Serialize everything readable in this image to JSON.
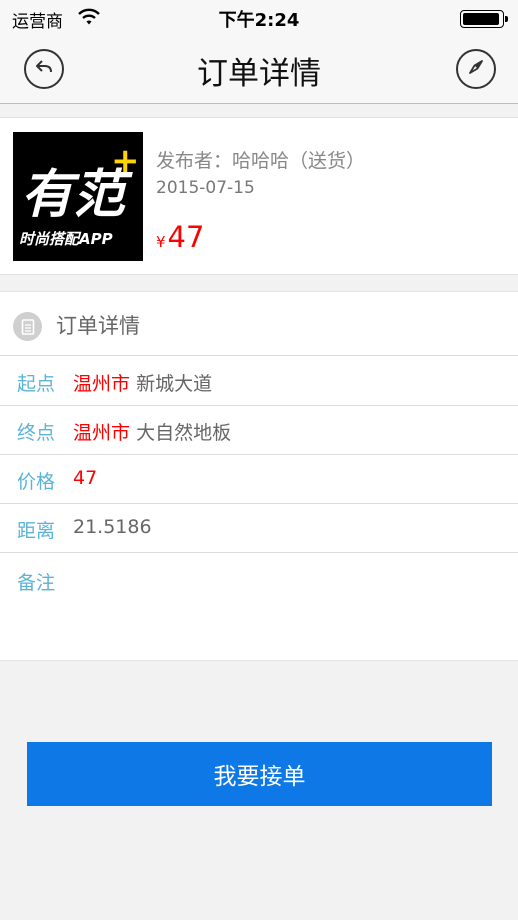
{
  "status": {
    "carrier": "运营商",
    "time": "下午2:24"
  },
  "nav": {
    "title": "订单详情"
  },
  "card": {
    "logo_text_big": "有范",
    "logo_plus": "+",
    "logo_text_small": "时尚搭配APP",
    "poster": "发布者：哈哈哈（送货）",
    "date": "2015-07-15",
    "currency": "¥",
    "price": "47"
  },
  "detail": {
    "title": "订单详情",
    "rows": [
      {
        "label": "起点",
        "city": "温州市",
        "place": "新城大道"
      },
      {
        "label": "终点",
        "city": "温州市",
        "place": "大自然地板"
      },
      {
        "label": "价格",
        "value": "47"
      },
      {
        "label": "距离",
        "value": "21.5186"
      }
    ],
    "note_label": "备注"
  },
  "action": {
    "accept_label": "我要接单"
  },
  "colors": {
    "accent_blue": "#0d78e6",
    "label_blue": "#5bb3d6",
    "price_red": "#ff0000"
  }
}
